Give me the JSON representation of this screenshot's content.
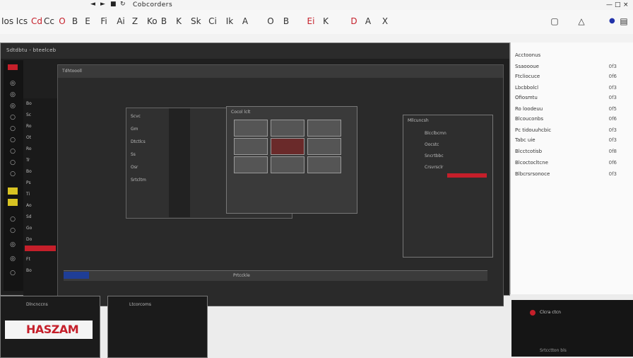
{
  "app": {
    "title": "Cobcorders"
  },
  "toolbar": {
    "buttons": [
      "Ios",
      "Ics",
      "Cd",
      "Cc",
      "O",
      "B",
      "E",
      "Fi",
      "Ai",
      "Z",
      "Ko",
      "B",
      "K",
      "Sk",
      "Ci",
      "Ik",
      "A",
      "O",
      "B",
      "Ei",
      "K",
      "D",
      "A",
      "X"
    ]
  },
  "main": {
    "header_text": "Sdtdbtu - bteelceb",
    "inner_header": "Tdhtoooll",
    "viewer_label": "Cocol lclt",
    "right_doc_header": "Mllcuncsh",
    "timeline_label": "Prtcckle",
    "side_labels": [
      "Bo",
      "Sc",
      "Ro",
      "Ot",
      "Ro",
      "Tr",
      "Bo",
      "Ps",
      "Ti",
      "Ao",
      "Sd",
      "Go",
      "Do",
      "Ft",
      "Bo"
    ],
    "editor_lines": [
      "Scvc",
      "Gm",
      "Dtctlcs",
      "Ss",
      "Osr",
      "Srtcltm"
    ],
    "right_doc_lines": [
      "Blcclbcmn",
      "Oocstc",
      "Sncrtbbc",
      "Crsvrsclr"
    ]
  },
  "right_panel": {
    "items": [
      {
        "label": "Acctoonus",
        "num": ""
      },
      {
        "label": "Ssaoooue",
        "num": "0f3"
      },
      {
        "label": "Ftcliocuce",
        "num": "0f6"
      },
      {
        "label": "Lbcbbolcl",
        "num": "0f3"
      },
      {
        "label": "Ofiosmtu",
        "num": "0f3"
      },
      {
        "label": "Ro loodeuu",
        "num": "0f5"
      },
      {
        "label": "Blcouconbs",
        "num": "0f6"
      },
      {
        "label": "Pc tidouuhcbic",
        "num": "0f3"
      },
      {
        "label": "Tabc uie",
        "num": "0f3"
      },
      {
        "label": "Blcctcotisb",
        "num": "0f8"
      },
      {
        "label": "Blcoctocltcne",
        "num": "0f6"
      },
      {
        "label": "Blbcrsrsonoce",
        "num": "0f3"
      }
    ]
  },
  "bottom": {
    "left_label": "Dlncnccns",
    "logo": "HASZAM",
    "mid_label": "Ltcorcoms",
    "right_label": "Clcra ctcn",
    "right_footer": "Srtcctton bls"
  },
  "colors": {
    "accent_red": "#c51f2a",
    "accent_yellow": "#d8c322",
    "accent_blue": "#1f3e96"
  }
}
